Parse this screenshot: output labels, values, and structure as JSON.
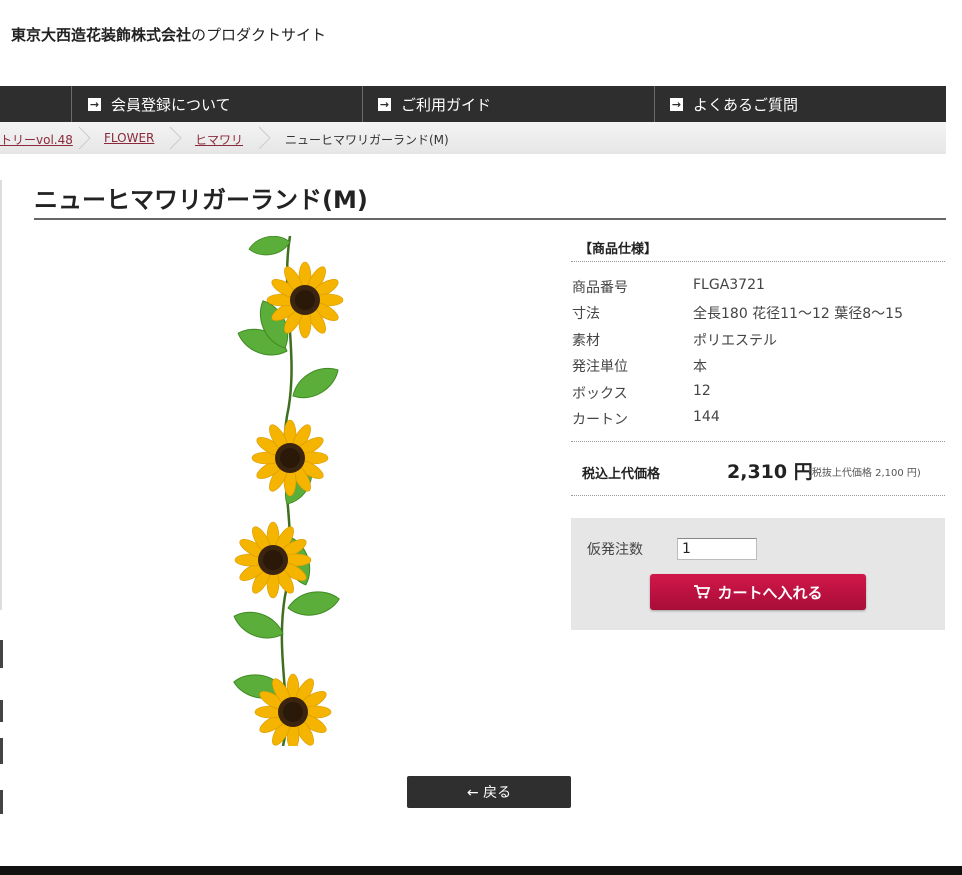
{
  "header": {
    "company": "東京大西造花装飾株式会社",
    "suffix": "のプロダクトサイト"
  },
  "nav": {
    "items": [
      {
        "label": "会員登録について"
      },
      {
        "label": "ご利用ガイド"
      },
      {
        "label": "よくあるご質問"
      }
    ]
  },
  "breadcrumb": {
    "items": [
      {
        "label": "トリーvol.48"
      },
      {
        "label": "FLOWER"
      },
      {
        "label": "ヒマワリ"
      }
    ],
    "current": "ニューヒマワリガーランド(M)"
  },
  "product": {
    "title": "ニューヒマワリガーランド(M)",
    "spec_heading": "【商品仕様】",
    "specs": [
      {
        "label": "商品番号",
        "value": "FLGA3721"
      },
      {
        "label": "寸法",
        "value": "全長180 花径11〜12 葉径8〜15"
      },
      {
        "label": "素材",
        "value": "ポリエステル"
      },
      {
        "label": "発注単位",
        "value": "本"
      },
      {
        "label": "ボックス",
        "value": "12"
      },
      {
        "label": "カートン",
        "value": "144"
      }
    ],
    "price_label": "税込上代価格",
    "price": "2,310 円",
    "price_note": "(税抜上代価格 2,100 円)"
  },
  "order": {
    "qty_label": "仮発注数",
    "qty_value": "1",
    "cart_label": "カートへ入れる"
  },
  "back_label": "← 戻る",
  "colors": {
    "nav_bg": "#2e2e2e",
    "cart_button": "#c4123f",
    "link": "#8a2a3a"
  }
}
